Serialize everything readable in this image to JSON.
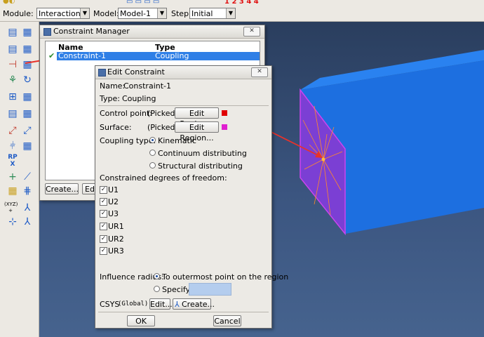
{
  "module_bar": {
    "module_label": "Module:",
    "module_value": "Interaction",
    "model_label": "Model:",
    "model_value": "Model-1",
    "step_label": "Step:",
    "step_value": "Initial"
  },
  "constraint_manager": {
    "title": "Constraint Manager",
    "col_name": "Name",
    "col_type": "Type",
    "rows": [
      {
        "name": "Constraint-1",
        "type": "Coupling"
      }
    ],
    "create_label": "Create...",
    "edit_label": "Ed"
  },
  "edit_constraint": {
    "title": "Edit Constraint",
    "name_label": "Name:",
    "name_value": "Constraint-1",
    "type_label": "Type:",
    "type_value": "Coupling",
    "control_point_label": "Control point:",
    "control_point_status": "(Picked)",
    "control_point_color": "#e00000",
    "surface_label": "Surface:",
    "surface_status": "(Picked)",
    "surface_color": "#e020d0",
    "edit_region_label": "Edit Region...",
    "coupling_type_label": "Coupling type:",
    "coupling_options": [
      "Kinematic",
      "Continuum distributing",
      "Structural distributing"
    ],
    "coupling_selected": "Kinematic",
    "dof_label": "Constrained degrees of freedom:",
    "dofs": [
      "U1",
      "U2",
      "U3",
      "UR1",
      "UR2",
      "UR3"
    ],
    "influence_label": "Influence radius:",
    "influence_option_outer": "To outermost point on the region",
    "influence_option_specify": "Specify:",
    "csys_label": "CSYS",
    "csys_value": "(Global)",
    "csys_edit": "Edit...",
    "csys_create": "Create...",
    "ok_label": "OK",
    "cancel_label": "Cancel"
  },
  "viewport": {
    "annotation_rp": "RP",
    "annotation_xyz": "(XYZ)"
  }
}
